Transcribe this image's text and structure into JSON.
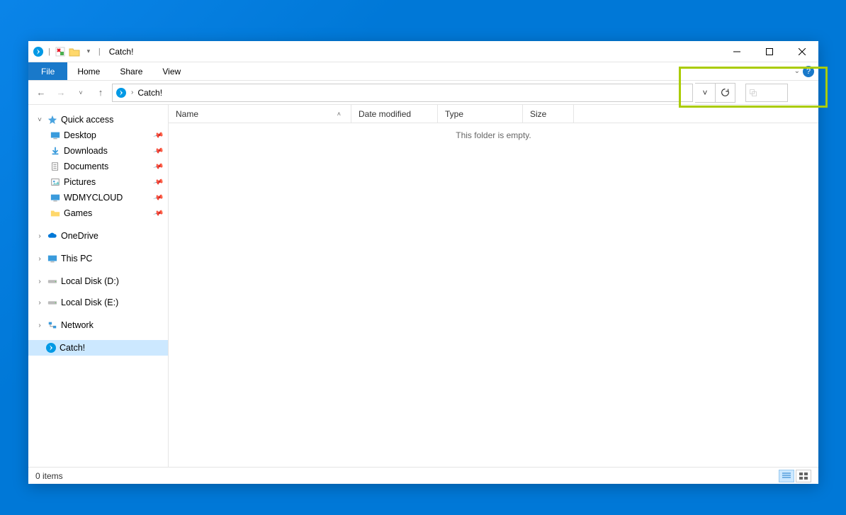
{
  "window": {
    "title": "Catch!",
    "min_tooltip": "Minimize",
    "max_tooltip": "Maximize",
    "close_tooltip": "Close"
  },
  "ribbon": {
    "file": "File",
    "tabs": [
      "Home",
      "Share",
      "View"
    ]
  },
  "address": {
    "location": "Catch!",
    "search_placeholder": ""
  },
  "nav": {
    "quick_access": "Quick access",
    "quick_items": [
      {
        "label": "Desktop",
        "pinned": true
      },
      {
        "label": "Downloads",
        "pinned": true
      },
      {
        "label": "Documents",
        "pinned": true
      },
      {
        "label": "Pictures",
        "pinned": true
      },
      {
        "label": "WDMYCLOUD",
        "pinned": true
      },
      {
        "label": "Games",
        "pinned": true
      }
    ],
    "onedrive": "OneDrive",
    "this_pc": "This PC",
    "drives": [
      {
        "label": "Local Disk (D:)"
      },
      {
        "label": "Local Disk (E:)"
      }
    ],
    "network": "Network",
    "catch": "Catch!"
  },
  "columns": {
    "name": "Name",
    "date": "Date modified",
    "type": "Type",
    "size": "Size"
  },
  "content": {
    "empty": "This folder is empty."
  },
  "status": {
    "items": "0 items"
  }
}
